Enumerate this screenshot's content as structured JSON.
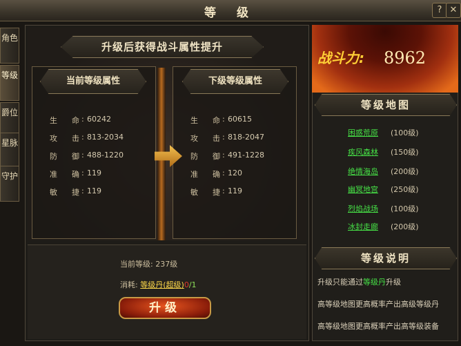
{
  "window": {
    "title": "等 级",
    "help_icon": "question-mark-icon",
    "close_icon": "close-x-icon"
  },
  "side_tabs": [
    {
      "label": "角色",
      "active": false
    },
    {
      "label": "等级",
      "active": true
    },
    {
      "label": "爵位",
      "active": false
    },
    {
      "label": "星脉",
      "active": false
    },
    {
      "label": "守护",
      "active": false
    }
  ],
  "main": {
    "banner": "升级后获得战斗属性提升",
    "current": {
      "title": "当前等级属性",
      "attrs": [
        {
          "k1": "生",
          "k2": "命",
          "value": "60242"
        },
        {
          "k1": "攻",
          "k2": "击",
          "value": "813-2034"
        },
        {
          "k1": "防",
          "k2": "御",
          "value": "488-1220"
        },
        {
          "k1": "准",
          "k2": "确",
          "value": "119"
        },
        {
          "k1": "敏",
          "k2": "捷",
          "value": "119"
        }
      ]
    },
    "next": {
      "title": "下级等级属性",
      "attrs": [
        {
          "k1": "生",
          "k2": "命",
          "value": "60615"
        },
        {
          "k1": "攻",
          "k2": "击",
          "value": "818-2047"
        },
        {
          "k1": "防",
          "k2": "御",
          "value": "491-1228"
        },
        {
          "k1": "准",
          "k2": "确",
          "value": "120"
        },
        {
          "k1": "敏",
          "k2": "捷",
          "value": "119"
        }
      ]
    },
    "current_level_label": "当前等级:",
    "current_level_value": "237级",
    "cost_label": "消耗:",
    "cost_item": "等级丹(超级)",
    "cost_have": "0",
    "cost_sep": "/",
    "cost_need": "1",
    "upgrade_button": "升级",
    "arrow_icon": "right-arrow-icon"
  },
  "right": {
    "power_label": "战斗力:",
    "power_value": "8962",
    "map_title": "等级地图",
    "maps": [
      {
        "name": "困惑荒原",
        "level": "(100级)"
      },
      {
        "name": "疾风森林",
        "level": "(150级)"
      },
      {
        "name": "绝情海岛",
        "level": "(200级)"
      },
      {
        "name": "幽冥地宫",
        "level": "(250级)"
      },
      {
        "name": "烈焰战场",
        "level": "(100级)"
      },
      {
        "name": "冰封走廊",
        "level": "(200级)"
      }
    ],
    "desc_title": "等级说明",
    "desc": {
      "line1_a": "升级只能通过",
      "line1_hl": "等级丹",
      "line1_b": "升级",
      "line2": "高等级地图更高概率产出高级等级丹",
      "line3": "高等级地图更高概率产出高等级装备"
    }
  }
}
